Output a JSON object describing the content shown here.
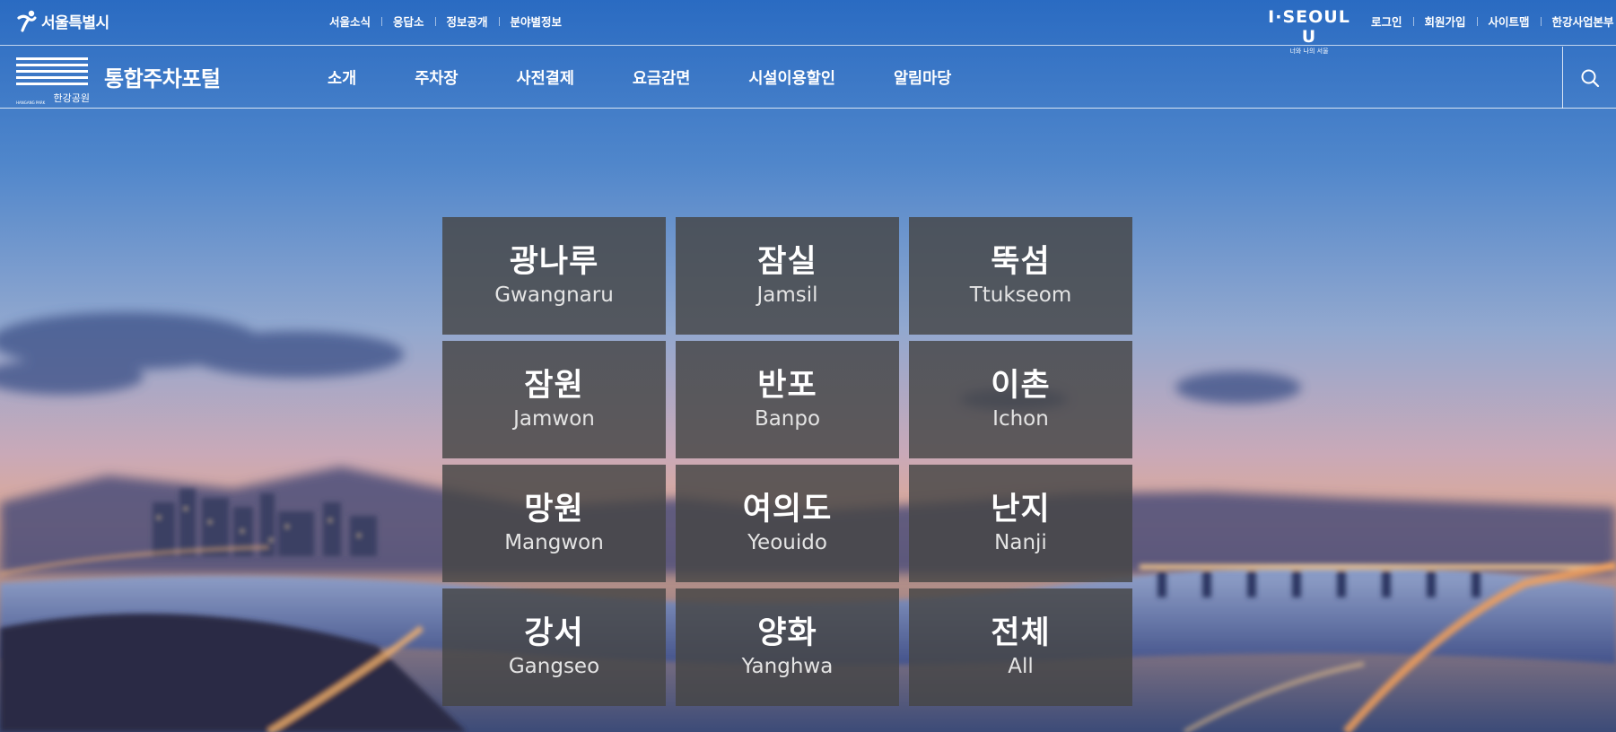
{
  "topbar": {
    "seoul_logo_text": "서울특별시",
    "links": [
      "서울소식",
      "응답소",
      "정보공개",
      "분야별정보"
    ],
    "iseoulu_main": "I·SEOUL U",
    "iseoulu_sub": "너와 나의 서울",
    "member_links": [
      "로그인",
      "회원가입",
      "사이트맵",
      "한강사업본부"
    ]
  },
  "navbar": {
    "logo_text": "한강공원",
    "logo_small": "HANGANG PARK",
    "portal_title": "통합주차포털",
    "menu": [
      "소개",
      "주차장",
      "사전결제",
      "요금감면",
      "시설이용할인",
      "알림마당"
    ],
    "search_icon": "search-icon"
  },
  "regions": [
    {
      "ko": "광나루",
      "en": "Gwangnaru"
    },
    {
      "ko": "잠실",
      "en": "Jamsil"
    },
    {
      "ko": "뚝섬",
      "en": "Ttukseom"
    },
    {
      "ko": "잠원",
      "en": "Jamwon"
    },
    {
      "ko": "반포",
      "en": "Banpo"
    },
    {
      "ko": "이촌",
      "en": "Ichon"
    },
    {
      "ko": "망원",
      "en": "Mangwon"
    },
    {
      "ko": "여의도",
      "en": "Yeouido"
    },
    {
      "ko": "난지",
      "en": "Nanji"
    },
    {
      "ko": "강서",
      "en": "Gangseo"
    },
    {
      "ko": "양화",
      "en": "Yanghwa"
    },
    {
      "ko": "전체",
      "en": "All"
    }
  ],
  "colors": {
    "sky_top": "#2f6fc0",
    "sky_mid": "#8fa6cc",
    "horizon": "#e2a889",
    "tile_bg": "#464646"
  }
}
